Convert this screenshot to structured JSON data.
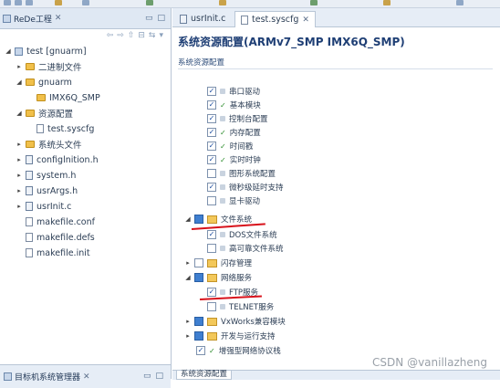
{
  "left_panel": {
    "title": "ReDe工程",
    "tree": [
      {
        "label": "test [gnuarm]",
        "icon": "project-icon"
      },
      {
        "label": "二进制文件",
        "icon": "binary-folder-icon"
      },
      {
        "label": "gnuarm",
        "icon": "folder-icon"
      },
      {
        "label": "IMX6Q_SMP",
        "icon": "folder-icon"
      },
      {
        "label": "资源配置",
        "icon": "folder-icon"
      },
      {
        "label": "test.syscfg",
        "icon": "syscfg-file-icon"
      },
      {
        "label": "系统头文件",
        "icon": "folder-icon"
      },
      {
        "label": "configlnition.h",
        "icon": "header-file-icon"
      },
      {
        "label": "system.h",
        "icon": "header-file-icon"
      },
      {
        "label": "usrArgs.h",
        "icon": "header-file-icon"
      },
      {
        "label": "usrInit.c",
        "icon": "c-file-icon"
      },
      {
        "label": "makefile.conf",
        "icon": "file-icon"
      },
      {
        "label": "makefile.defs",
        "icon": "file-icon"
      },
      {
        "label": "makefile.init",
        "icon": "file-icon"
      }
    ],
    "bottom_title": "目标机系统管理器"
  },
  "editor": {
    "tabs": [
      {
        "label": "usrInit.c",
        "active": false
      },
      {
        "label": "test.syscfg",
        "active": true
      }
    ],
    "title": "系统资源配置(ARMv7_SMP IMX6Q_SMP)",
    "section_label": "系统资源配置",
    "items": [
      {
        "label": "串口驱动",
        "checked": true,
        "mark": "none"
      },
      {
        "label": "基本模块",
        "checked": true,
        "mark": "green"
      },
      {
        "label": "控制台配置",
        "checked": true,
        "mark": "none"
      },
      {
        "label": "内存配置",
        "checked": true,
        "mark": "green"
      },
      {
        "label": "时间戳",
        "checked": true,
        "mark": "green"
      },
      {
        "label": "实时时钟",
        "checked": true,
        "mark": "green"
      },
      {
        "label": "图形系统配置",
        "checked": false,
        "mark": "none"
      },
      {
        "label": "微秒级延时支持",
        "checked": true,
        "mark": "none"
      },
      {
        "label": "显卡驱动",
        "checked": false,
        "mark": "none"
      },
      {
        "label": "文件系统",
        "checked": false,
        "mark": "folder"
      },
      {
        "label": "DOS文件系统",
        "checked": true,
        "mark": "none"
      },
      {
        "label": "高可靠文件系统",
        "checked": false,
        "mark": "none"
      },
      {
        "label": "闪存管理",
        "checked": false,
        "mark": "folder"
      },
      {
        "label": "网络服务",
        "checked": false,
        "mark": "folder"
      },
      {
        "label": "FTP服务",
        "checked": true,
        "mark": "none"
      },
      {
        "label": "TELNET服务",
        "checked": false,
        "mark": "none"
      },
      {
        "label": "VxWorks兼容模块",
        "checked": false,
        "mark": "folder"
      },
      {
        "label": "开发与运行支持",
        "checked": false,
        "mark": "folder"
      },
      {
        "label": "增强型网络协议栈",
        "checked": true,
        "mark": "none"
      }
    ],
    "bottom_tab": "系统资源配置"
  },
  "watermark": "CSDN @vanillazheng",
  "colors": {
    "accent": "#1f3f75",
    "annotation_red": "#d8121b",
    "panel_bg": "#dfe8f3"
  }
}
